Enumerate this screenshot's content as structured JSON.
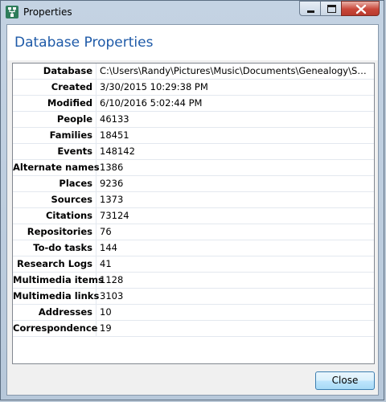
{
  "window": {
    "title": "Properties"
  },
  "dialog": {
    "heading": "Database Properties"
  },
  "properties": [
    {
      "label": "Database",
      "value": "C:\\Users\\Randy\\Pictures\\Music\\Documents\\Genealogy\\Soft..."
    },
    {
      "label": "Created",
      "value": "3/30/2015 10:29:38 PM"
    },
    {
      "label": "Modified",
      "value": "6/10/2016 5:02:44 PM"
    },
    {
      "label": "People",
      "value": "46133"
    },
    {
      "label": "Families",
      "value": "18451"
    },
    {
      "label": "Events",
      "value": "148142"
    },
    {
      "label": "Alternate names",
      "value": "1386"
    },
    {
      "label": "Places",
      "value": "9236"
    },
    {
      "label": "Sources",
      "value": "1373"
    },
    {
      "label": "Citations",
      "value": "73124"
    },
    {
      "label": "Repositories",
      "value": "76"
    },
    {
      "label": "To-do tasks",
      "value": "144"
    },
    {
      "label": "Research Logs",
      "value": "41"
    },
    {
      "label": "Multimedia items",
      "value": "1128"
    },
    {
      "label": "Multimedia links",
      "value": "3103"
    },
    {
      "label": "Addresses",
      "value": "10"
    },
    {
      "label": "Correspondence",
      "value": "19"
    }
  ],
  "buttons": {
    "close_label": "Close"
  },
  "icons": {
    "app": "family-tree-icon",
    "minimize": "minimize-icon",
    "maximize": "maximize-icon",
    "close": "close-icon"
  },
  "colors": {
    "heading": "#1e5aa8",
    "close_button": "#c9473a"
  }
}
